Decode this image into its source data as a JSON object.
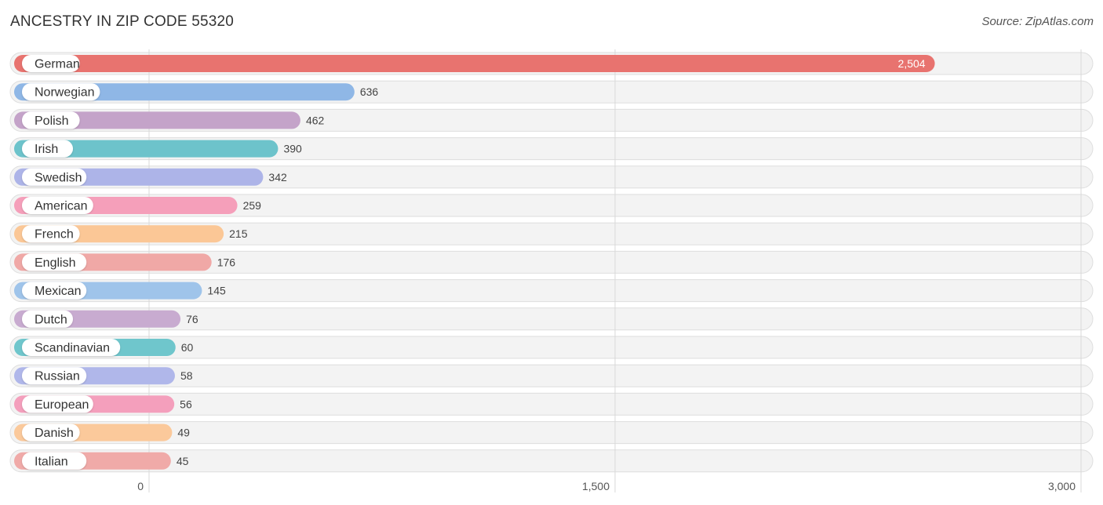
{
  "header": {
    "title": "ANCESTRY IN ZIP CODE 55320",
    "source": "Source: ZipAtlas.com"
  },
  "chart_data": {
    "type": "bar",
    "orientation": "horizontal",
    "title": "ANCESTRY IN ZIP CODE 55320",
    "xlabel": "",
    "ylabel": "",
    "xlim": [
      0,
      3000
    ],
    "x_ticks": [
      0,
      1500,
      3000
    ],
    "x_tick_labels": [
      "0",
      "1,500",
      "3,000"
    ],
    "grid": true,
    "categories": [
      "German",
      "Norwegian",
      "Polish",
      "Irish",
      "Swedish",
      "American",
      "French",
      "English",
      "Mexican",
      "Dutch",
      "Scandinavian",
      "Russian",
      "European",
      "Danish",
      "Italian"
    ],
    "values": [
      2504,
      636,
      462,
      390,
      342,
      259,
      215,
      176,
      145,
      76,
      60,
      58,
      56,
      49,
      45
    ],
    "value_labels": [
      "2,504",
      "636",
      "462",
      "390",
      "342",
      "259",
      "215",
      "176",
      "145",
      "76",
      "60",
      "58",
      "56",
      "49",
      "45"
    ],
    "colors": [
      "#e8736f",
      "#8fb7e6",
      "#c4a3c9",
      "#6dc3cb",
      "#adb4e8",
      "#f59fba",
      "#fbc796",
      "#f0a8a6",
      "#9fc4ea",
      "#c8abd0",
      "#6fc6cc",
      "#b0b7ea",
      "#f49fbc",
      "#fbc99b",
      "#f0aaa8"
    ]
  }
}
